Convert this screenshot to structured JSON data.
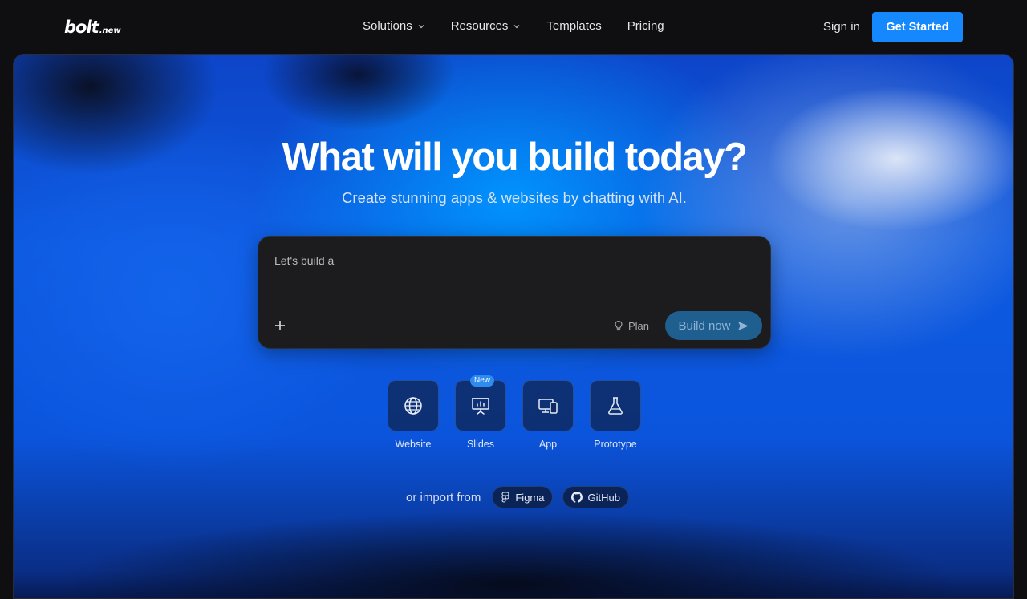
{
  "brand": {
    "logo": "bolt",
    "logo_suffix": ".new"
  },
  "nav": {
    "items": [
      {
        "label": "Solutions",
        "has_dropdown": true
      },
      {
        "label": "Resources",
        "has_dropdown": true
      },
      {
        "label": "Templates",
        "has_dropdown": false
      },
      {
        "label": "Pricing",
        "has_dropdown": false
      }
    ],
    "sign_in": "Sign in",
    "get_started": "Get Started"
  },
  "hero": {
    "headline": "What will you build today?",
    "subheadline": "Create stunning apps & websites by chatting with AI."
  },
  "prompt": {
    "placeholder": "Let's build a",
    "value": "",
    "plus_icon": "plus-icon",
    "plan_label": "Plan",
    "plan_icon": "lightbulb-icon",
    "build_label": "Build now",
    "build_icon": "send-icon"
  },
  "project_types": [
    {
      "label": "Website",
      "icon": "globe-icon",
      "badge": ""
    },
    {
      "label": "Slides",
      "icon": "presentation-icon",
      "badge": "New"
    },
    {
      "label": "App",
      "icon": "devices-icon",
      "badge": ""
    },
    {
      "label": "Prototype",
      "icon": "flask-icon",
      "badge": ""
    }
  ],
  "import": {
    "text": "or import from",
    "sources": [
      {
        "label": "Figma",
        "icon": "figma-icon"
      },
      {
        "label": "GitHub",
        "icon": "github-icon"
      }
    ]
  },
  "colors": {
    "accent": "#1488fc",
    "background": "#0f0f11",
    "prompt_bg": "#1c1c1f",
    "build_button": "#1f5f8f"
  }
}
